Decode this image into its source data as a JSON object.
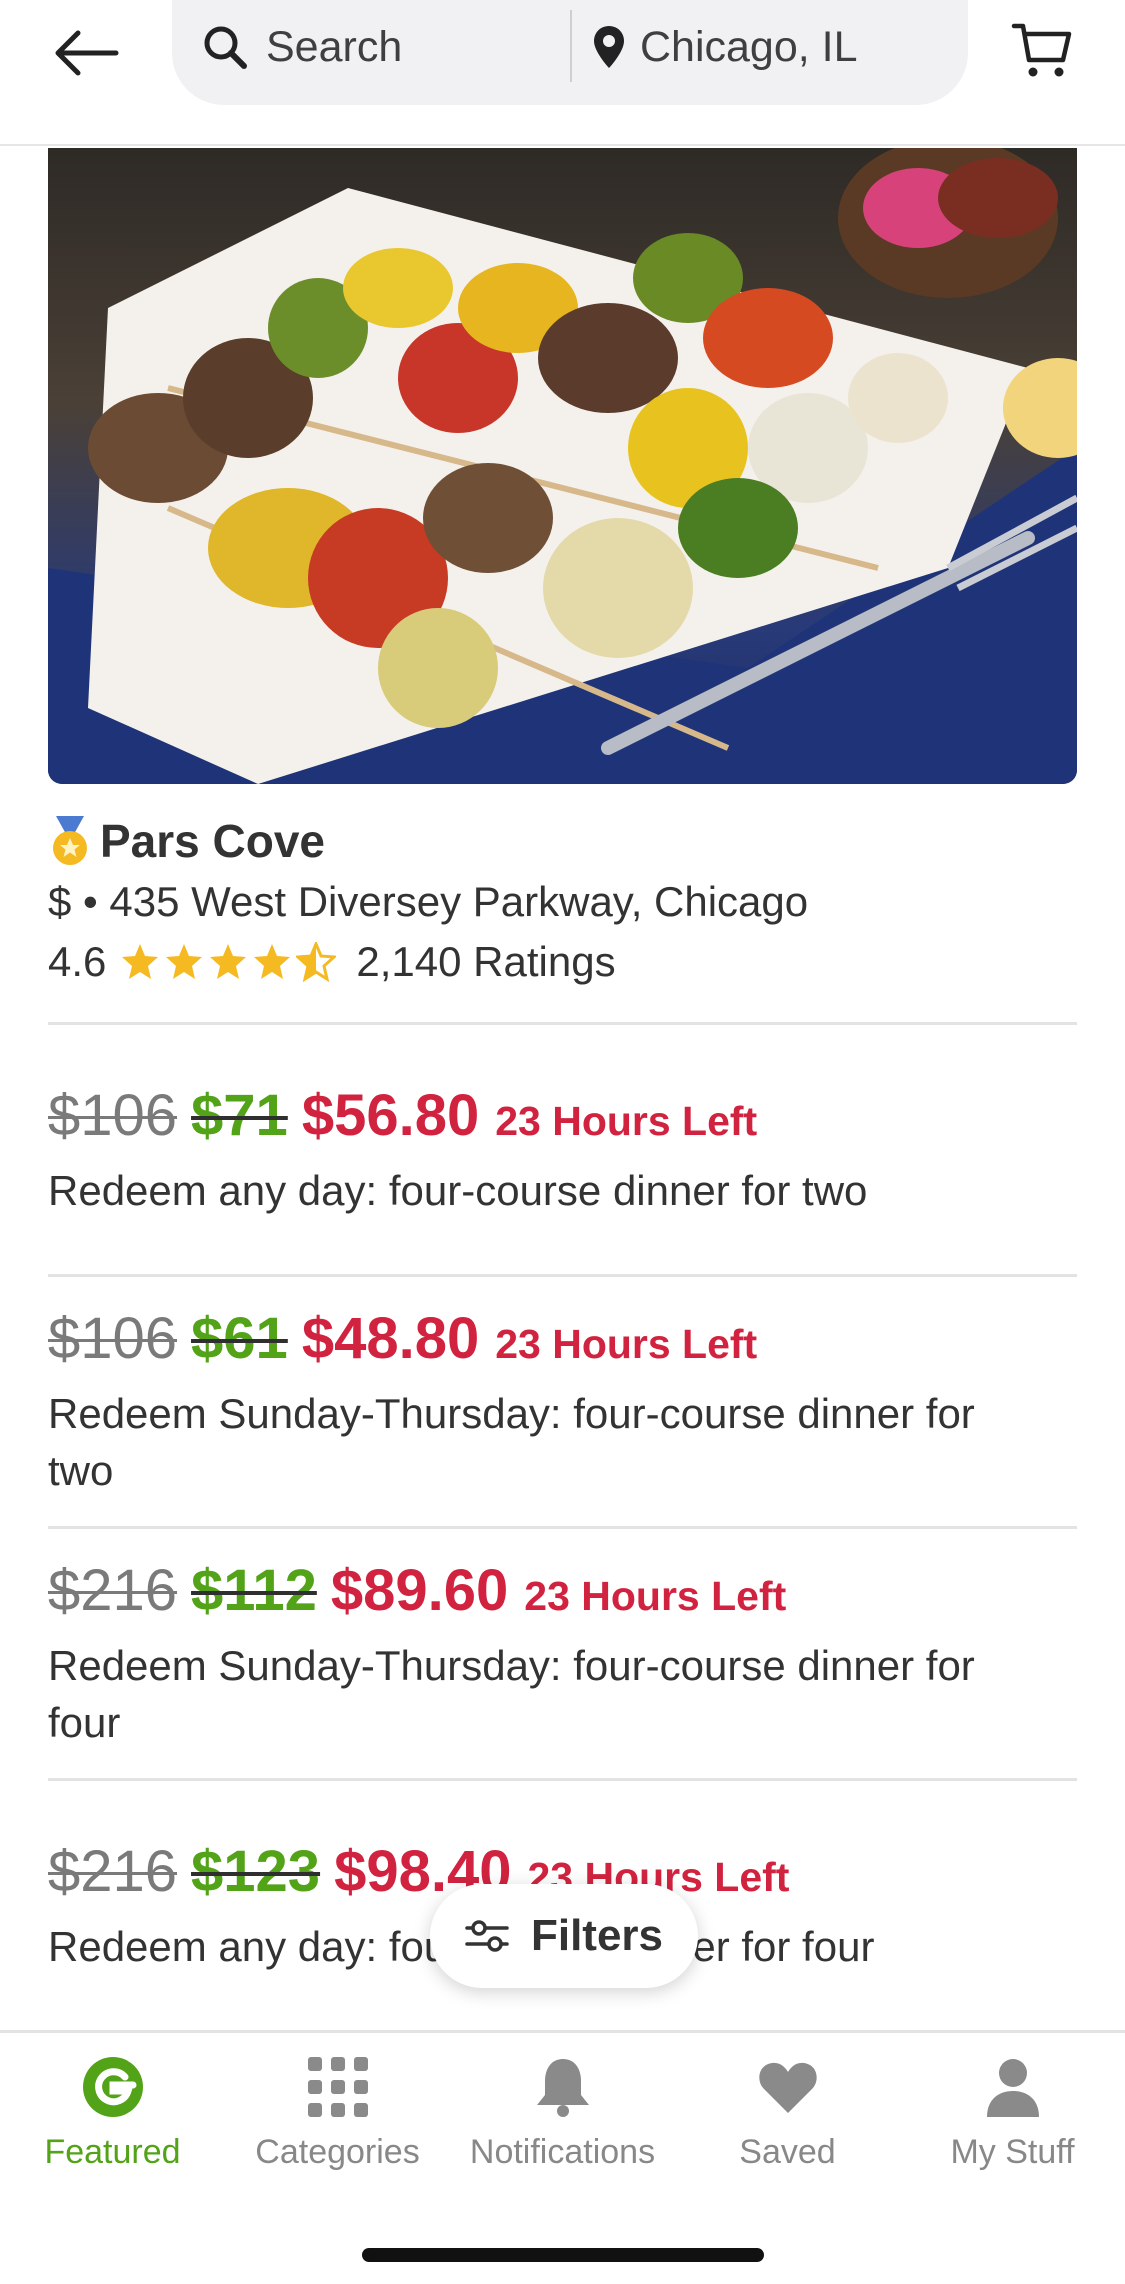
{
  "header": {
    "search_placeholder": "Search",
    "location": "Chicago, IL"
  },
  "merchant": {
    "name": "Pars Cove",
    "address": "$ • 435 West Diversey Parkway, Chicago",
    "rating": "4.6",
    "rating_value": 4.6,
    "rating_count": "2,140 Ratings"
  },
  "deals": [
    {
      "original": "$106",
      "sale": "$71",
      "promo": "$56.80",
      "time_left": "23 Hours Left",
      "description": "Redeem any day: four-course dinner for two"
    },
    {
      "original": "$106",
      "sale": "$61",
      "promo": "$48.80",
      "time_left": "23 Hours Left",
      "description": "Redeem Sunday-Thursday: four-course dinner for two"
    },
    {
      "original": "$216",
      "sale": "$112",
      "promo": "$89.60",
      "time_left": "23 Hours Left",
      "description": "Redeem Sunday-Thursday: four-course dinner for four"
    },
    {
      "original": "$216",
      "sale": "$123",
      "promo": "$98.40",
      "time_left": "23 Hours Left",
      "description": "Redeem any day: four-course dinner for four"
    }
  ],
  "filters_label": "Filters",
  "nav": [
    {
      "label": "Featured",
      "icon": "groupon-g-icon",
      "active": true
    },
    {
      "label": "Categories",
      "icon": "grid-icon",
      "active": false
    },
    {
      "label": "Notifications",
      "icon": "bell-icon",
      "active": false
    },
    {
      "label": "Saved",
      "icon": "heart-icon",
      "active": false
    },
    {
      "label": "My Stuff",
      "icon": "person-icon",
      "active": false
    }
  ],
  "colors": {
    "green": "#53a318",
    "red": "#d1233f",
    "gold": "#f5b921"
  }
}
